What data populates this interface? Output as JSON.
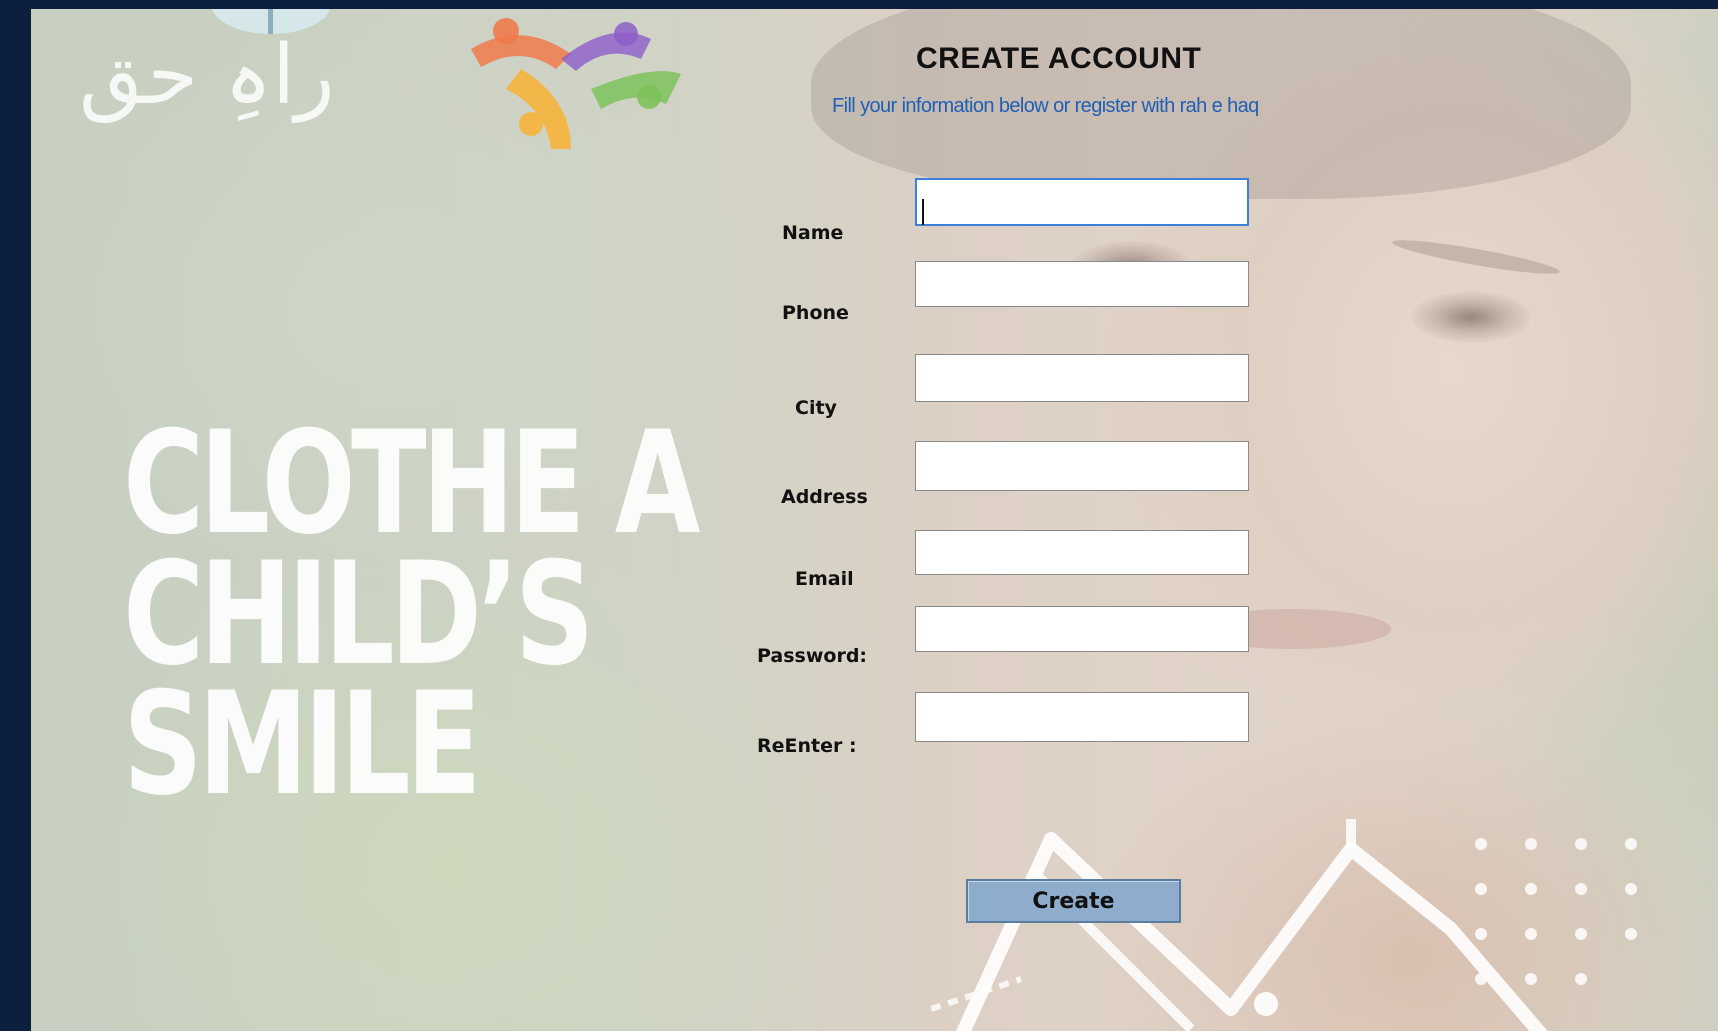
{
  "branding": {
    "logo_text": "راہِ حق"
  },
  "slogan": {
    "line1": "CLOTHE A",
    "line2": "CHILD’S",
    "line3": "SMILE"
  },
  "form": {
    "title": "CREATE ACCOUNT",
    "subtitle": "Fill your information below or register with rah e haq",
    "fields": [
      {
        "label": "Name",
        "value": "",
        "focused": true
      },
      {
        "label": "Phone",
        "value": ""
      },
      {
        "label": "City",
        "value": ""
      },
      {
        "label": "Address",
        "value": ""
      },
      {
        "label": "Email",
        "value": ""
      },
      {
        "label": "Password:",
        "value": ""
      },
      {
        "label": "ReEnter :",
        "value": ""
      }
    ],
    "submit_label": "Create"
  },
  "colors": {
    "accent_link": "#1f5fb5",
    "button_fill": "#8eadcd",
    "focus_border": "#3f7fd6",
    "page_frame": "#0d1f3e"
  }
}
